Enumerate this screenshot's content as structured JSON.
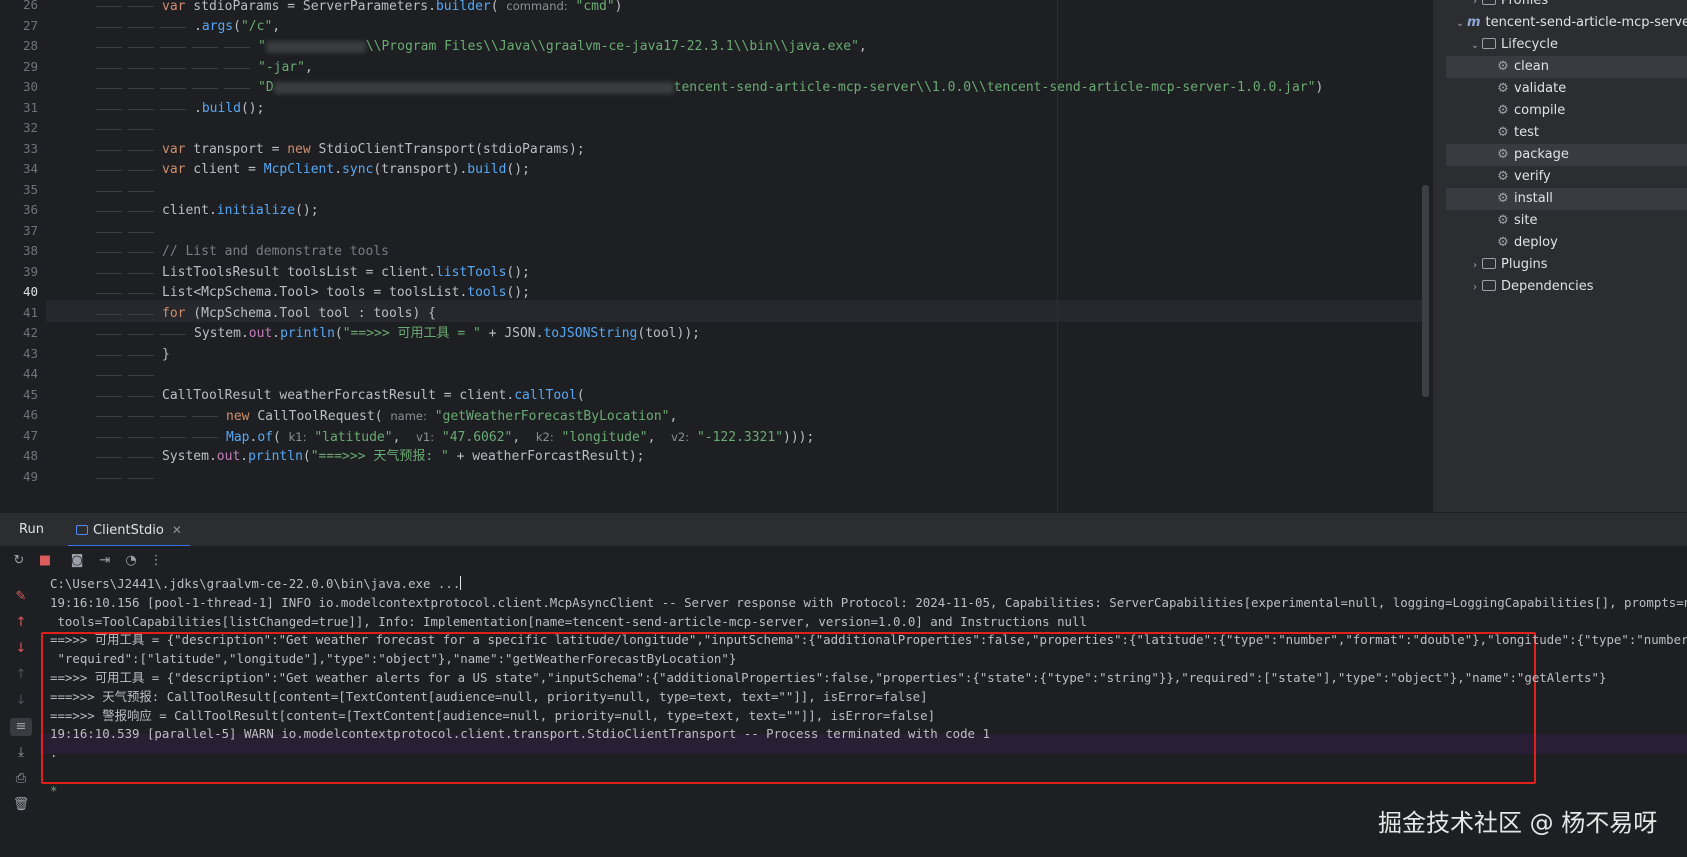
{
  "editor": {
    "lines": [
      {
        "n": "26",
        "html": "<span class='kw'>var</span> stdioParams = <span class='ty'>ServerParameters</span>.<span class='fn'>builder</span>( <span class='hint'>command:</span> <span class='str'>\"cmd\"</span>)",
        "indent": 162
      },
      {
        "n": "27",
        "html": ".<span class='fn'>args</span>(<span class='str'>\"/c\"</span>,",
        "indent": 194
      },
      {
        "n": "28",
        "html": "<span class='str'>\"</span><span class='blur' style='width:100px'></span><span class='str'>\\\\Program Files\\\\Java\\\\graalvm-ce-java17-22.3.1\\\\bin\\\\java.exe\"</span>,",
        "indent": 258
      },
      {
        "n": "29",
        "html": "<span class='str'>\"-jar\"</span>,",
        "indent": 258
      },
      {
        "n": "30",
        "html": "<span class='str'>\"D</span><span class='blur' style='width:400px'></span><span class='str'>tencent-send-article-mcp-server\\\\1.0.0\\\\tencent-send-article-mcp-server-1.0.0.jar\"</span>)",
        "indent": 258
      },
      {
        "n": "31",
        "html": ".<span class='fn'>build</span>();",
        "indent": 194
      },
      {
        "n": "32",
        "html": "",
        "indent": 162
      },
      {
        "n": "33",
        "html": "<span class='kw'>var</span> transport = <span class='kw'>new</span> <span class='ty'>StdioClientTransport</span>(stdioParams);",
        "indent": 162
      },
      {
        "n": "34",
        "html": "<span class='kw'>var</span> client = <span class='fn'>McpClient</span>.<span class='fn'>sync</span>(transport).<span class='fn'>build</span>();",
        "indent": 162
      },
      {
        "n": "35",
        "html": "",
        "indent": 162
      },
      {
        "n": "36",
        "html": "client.<span class='fn'>initialize</span>();",
        "indent": 162
      },
      {
        "n": "37",
        "html": "",
        "indent": 162
      },
      {
        "n": "38",
        "html": "<span class='cmt'>// List and demonstrate tools</span>",
        "indent": 162
      },
      {
        "n": "39",
        "html": "<span class='ty'>ListToolsResult</span> toolsList = client.<span class='fn'>listTools</span>();",
        "indent": 162
      },
      {
        "n": "40",
        "html": "<span class='ty'>List</span>&lt;<span class='ty'>McpSchema</span>.<span class='ty'>Tool</span>&gt; tools = toolsList.<span class='fn'>tools</span>();",
        "indent": 162
      },
      {
        "n": "41",
        "html": "<span class='kw'>for</span> (<span class='ty'>McpSchema</span>.<span class='ty'>Tool</span> tool : tools) {",
        "indent": 162
      },
      {
        "n": "42",
        "html": "<span class='ty'>System</span>.<span class='fld'>out</span>.<span class='fn'>println</span>(<span class='str'>\"==>>> 可用工具 = \"</span> + <span class='ty'>JSON</span>.<span class='fn'>toJSONString</span>(tool));",
        "indent": 194
      },
      {
        "n": "43",
        "html": "}",
        "indent": 162
      },
      {
        "n": "44",
        "html": "",
        "indent": 162
      },
      {
        "n": "45",
        "html": "<span class='ty'>CallToolResult</span> weatherForcastResult = client.<span class='fn'>callTool</span>(",
        "indent": 162
      },
      {
        "n": "46",
        "html": "<span class='kw'>new</span> <span class='ty'>CallToolRequest</span>( <span class='hint'>name:</span> <span class='str'>\"getWeatherForecastByLocation\"</span>,",
        "indent": 226
      },
      {
        "n": "47",
        "html": "<span class='fn'>Map</span>.<span class='fn'>of</span>( <span class='hint'>k1:</span> <span class='str'>\"latitude\"</span>,  <span class='hint'>v1:</span> <span class='str'>\"47.6062\"</span>,  <span class='hint'>k2:</span> <span class='str'>\"longitude\"</span>,  <span class='hint'>v2:</span> <span class='str'>\"-122.3321\"</span>)));",
        "indent": 226
      },
      {
        "n": "48",
        "html": "<span class='ty'>System</span>.<span class='fld'>out</span>.<span class='fn'>println</span>(<span class='str'>\"===>>> 天气预报: \"</span> + weatherForcastResult);",
        "indent": 162
      },
      {
        "n": "49",
        "html": "",
        "indent": 162
      }
    ],
    "current_line": "40"
  },
  "maven": {
    "items": [
      {
        "label": "Profiles",
        "kind": "folder",
        "level": 1,
        "chevron": "›"
      },
      {
        "label": "tencent-send-article-mcp-server",
        "kind": "module",
        "level": 0,
        "chevron": "⌄"
      },
      {
        "label": "Lifecycle",
        "kind": "folder",
        "level": 1,
        "chevron": "⌄"
      },
      {
        "label": "clean",
        "kind": "goal",
        "level": 2,
        "selected": true
      },
      {
        "label": "validate",
        "kind": "goal",
        "level": 2
      },
      {
        "label": "compile",
        "kind": "goal",
        "level": 2
      },
      {
        "label": "test",
        "kind": "goal",
        "level": 2
      },
      {
        "label": "package",
        "kind": "goal",
        "level": 2,
        "selected": true
      },
      {
        "label": "verify",
        "kind": "goal",
        "level": 2
      },
      {
        "label": "install",
        "kind": "goal",
        "level": 2,
        "selected": true
      },
      {
        "label": "site",
        "kind": "goal",
        "level": 2
      },
      {
        "label": "deploy",
        "kind": "goal",
        "level": 2
      },
      {
        "label": "Plugins",
        "kind": "folder",
        "level": 1,
        "chevron": "›"
      },
      {
        "label": "Dependencies",
        "kind": "folder",
        "level": 1,
        "chevron": "›"
      }
    ]
  },
  "run": {
    "tab_run": "Run",
    "tab_client": "ClientStdio",
    "close": "✕"
  },
  "console": {
    "lines": [
      "C:\\Users\\J2441\\.jdks\\graalvm-ce-22.0.0\\bin\\java.exe ...",
      "19:16:10.156 [pool-1-thread-1] INFO io.modelcontextprotocol.client.McpAsyncClient -- Server response with Protocol: 2024-11-05, Capabilities: ServerCapabilities[experimental=null, logging=LoggingCapabilities[], prompts=null, resources",
      " tools=ToolCapabilities[listChanged=true]], Info: Implementation[name=tencent-send-article-mcp-server, version=1.0.0] and Instructions null",
      "==>>> 可用工具 = {\"description\":\"Get weather forecast for a specific latitude/longitude\",\"inputSchema\":{\"additionalProperties\":false,\"properties\":{\"latitude\":{\"type\":\"number\",\"format\":\"double\"},\"longitude\":{\"type\":\"number\",\"format\":\"do",
      " \"required\":[\"latitude\",\"longitude\"],\"type\":\"object\"},\"name\":\"getWeatherForecastByLocation\"}",
      "==>>> 可用工具 = {\"description\":\"Get weather alerts for a US state\",\"inputSchema\":{\"additionalProperties\":false,\"properties\":{\"state\":{\"type\":\"string\"}},\"required\":[\"state\"],\"type\":\"object\"},\"name\":\"getAlerts\"}",
      "===>>> 天气预报: CallToolResult[content=[TextContent[audience=null, priority=null, type=text, text=\"\"]], isError=false]",
      "===>>> 警报响应 = CallToolResult[content=[TextContent[audience=null, priority=null, type=text, text=\"\"]], isError=false]",
      "19:16:10.539 [parallel-5] WARN io.modelcontextprotocol.client.transport.StdioClientTransport -- Process terminated with code 1",
      ".",
      "",
      "*"
    ]
  },
  "watermark": "掘金技术社区 @ 杨不易呀",
  "colors": {
    "accent": "#3574f0",
    "highlight_box": "#e0201b",
    "warn_bg": "#2a1e35"
  }
}
